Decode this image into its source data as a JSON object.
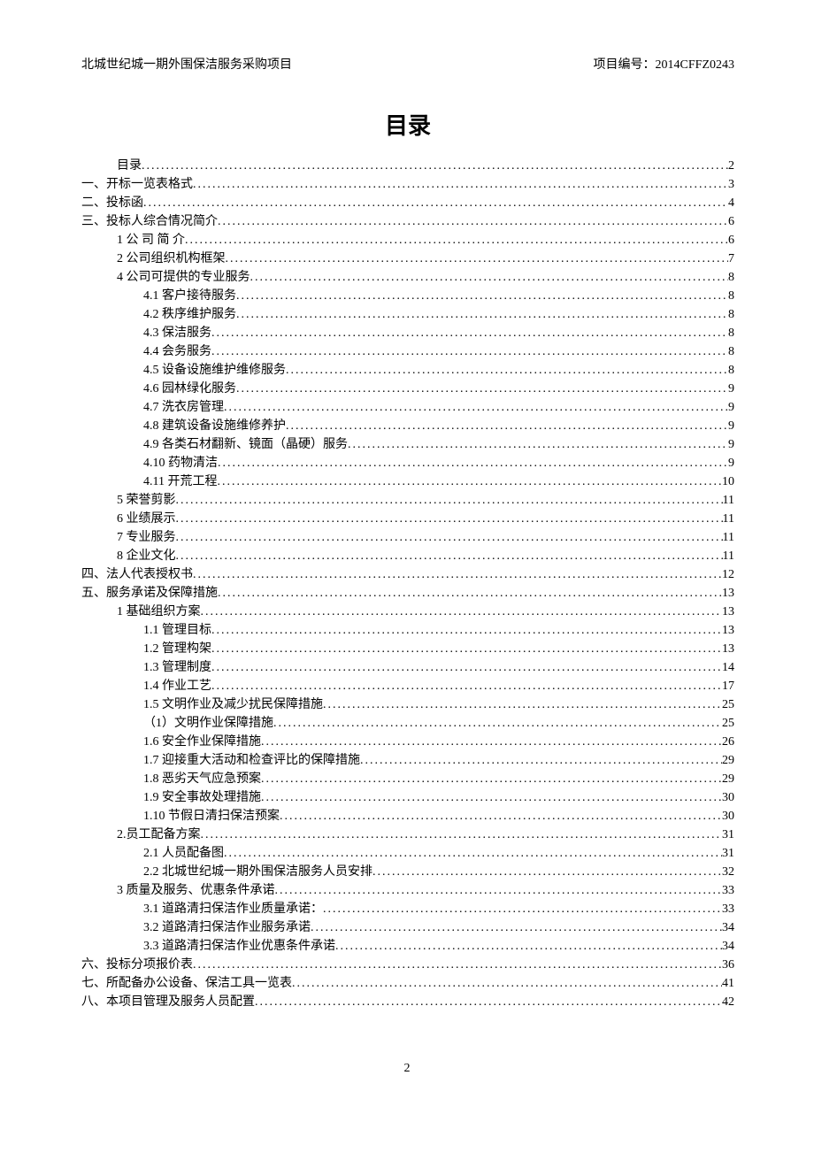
{
  "header": {
    "left": "北城世纪城一期外围保洁服务采购项目",
    "right_label": "项目编号：",
    "right_value": "2014CFFZ0243"
  },
  "title": "目录",
  "toc": [
    {
      "label": "目录",
      "page": "2",
      "indent": 1
    },
    {
      "label": "一、开标一览表格式",
      "page": "3",
      "indent": 0
    },
    {
      "label": "二、投标函",
      "page": "4",
      "indent": 0
    },
    {
      "label": "三、投标人综合情况简介",
      "page": "6",
      "indent": 0
    },
    {
      "label": "1 公 司 简 介",
      "page": "6",
      "indent": 1
    },
    {
      "label": "2 公司组织机构框架",
      "page": "7",
      "indent": 1
    },
    {
      "label": "4 公司可提供的专业服务",
      "page": "8",
      "indent": 1
    },
    {
      "label": "4.1 客户接待服务",
      "page": "8",
      "indent": 2
    },
    {
      "label": "4.2 秩序维护服务",
      "page": "8",
      "indent": 2
    },
    {
      "label": "4.3 保洁服务",
      "page": "8",
      "indent": 2
    },
    {
      "label": "4.4 会务服务",
      "page": "8",
      "indent": 2
    },
    {
      "label": "4.5 设备设施维护维修服务",
      "page": "8",
      "indent": 2
    },
    {
      "label": "4.6 园林绿化服务",
      "page": "9",
      "indent": 2
    },
    {
      "label": "4.7 洗衣房管理",
      "page": "9",
      "indent": 2
    },
    {
      "label": "4.8 建筑设备设施维修养护",
      "page": "9",
      "indent": 2
    },
    {
      "label": "4.9 各类石材翻新、镜面（晶硬）服务",
      "page": "9",
      "indent": 2
    },
    {
      "label": "4.10 药物清洁",
      "page": "9",
      "indent": 2
    },
    {
      "label": "4.11 开荒工程",
      "page": "10",
      "indent": 2
    },
    {
      "label": "5 荣誉剪影",
      "page": "11",
      "indent": 1
    },
    {
      "label": "6 业绩展示",
      "page": "11",
      "indent": 1
    },
    {
      "label": "7 专业服务",
      "page": "11",
      "indent": 1
    },
    {
      "label": "8 企业文化",
      "page": "11",
      "indent": 1
    },
    {
      "label": "四、法人代表授权书",
      "page": "12",
      "indent": 0
    },
    {
      "label": "五、服务承诺及保障措施",
      "page": "13",
      "indent": 0
    },
    {
      "label": "1 基础组织方案",
      "page": "13",
      "indent": 1
    },
    {
      "label": "1.1 管理目标",
      "page": "13",
      "indent": 2
    },
    {
      "label": "1.2 管理构架",
      "page": "13",
      "indent": 2
    },
    {
      "label": "1.3 管理制度",
      "page": "14",
      "indent": 2
    },
    {
      "label": "1.4 作业工艺",
      "page": "17",
      "indent": 2
    },
    {
      "label": "1.5 文明作业及减少扰民保障措施",
      "page": "25",
      "indent": 2
    },
    {
      "label": "（1）文明作业保障措施",
      "page": "25",
      "indent": 2
    },
    {
      "label": "1.6 安全作业保障措施",
      "page": "26",
      "indent": 2
    },
    {
      "label": "1.7 迎接重大活动和检查评比的保障措施",
      "page": "29",
      "indent": 2
    },
    {
      "label": "1.8 恶劣天气应急预案",
      "page": "29",
      "indent": 2
    },
    {
      "label": "1.9 安全事故处理措施",
      "page": "30",
      "indent": 2
    },
    {
      "label": "1.10 节假日清扫保洁预案",
      "page": "30",
      "indent": 2
    },
    {
      "label": "2.员工配备方案",
      "page": "31",
      "indent": 1
    },
    {
      "label": "2.1 人员配备图",
      "page": "31",
      "indent": 2
    },
    {
      "label": "2.2 北城世纪城一期外围保洁服务人员安排",
      "page": "32",
      "indent": 2
    },
    {
      "label": "3 质量及服务、优惠条件承诺",
      "page": "33",
      "indent": 1
    },
    {
      "label": "3.1 道路清扫保洁作业质量承诺：",
      "page": "33",
      "indent": 2
    },
    {
      "label": "3.2 道路清扫保洁作业服务承诺",
      "page": "34",
      "indent": 2
    },
    {
      "label": "3.3 道路清扫保洁作业优惠条件承诺",
      "page": "34",
      "indent": 2
    },
    {
      "label": "六、投标分项报价表",
      "page": "36",
      "indent": 0
    },
    {
      "label": "七、所配备办公设备、保洁工具一览表",
      "page": "41",
      "indent": 0
    },
    {
      "label": "八、本项目管理及服务人员配置",
      "page": "42",
      "indent": 0
    }
  ],
  "footer": {
    "page_number": "2"
  }
}
